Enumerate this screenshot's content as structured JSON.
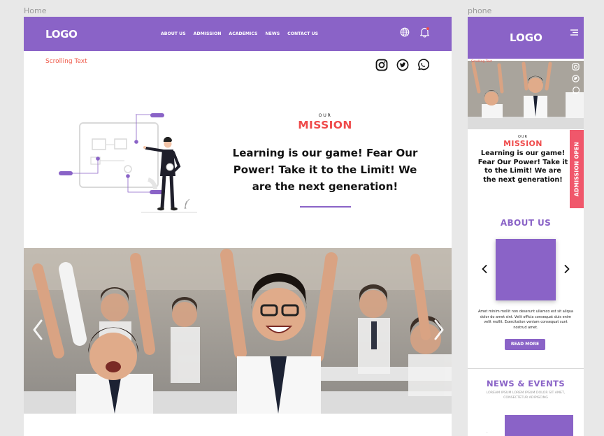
{
  "frames": {
    "home_label": "Home",
    "phone_label": "phone"
  },
  "header": {
    "logo": "LOGO",
    "nav": [
      "ABOUT US",
      "ADMISSION",
      "ACADEMICS",
      "NEWS",
      "CONTACT US"
    ],
    "icons": [
      "globe-icon",
      "bell-icon"
    ],
    "notification_dot_color": "#ef4b4b"
  },
  "scrolling_text": "Scrolling Text",
  "social_icons": [
    "instagram-icon",
    "twitter-icon",
    "whatsapp-icon"
  ],
  "mission": {
    "eyebrow": "OUR",
    "title": "MISSION",
    "text": "Learning is our game! Fear Our Power! Take it to the Limit! We are the next generation!"
  },
  "hero": {
    "image": "students-cheering-photo",
    "prev_icon": "chevron-left-icon",
    "next_icon": "chevron-right-icon"
  },
  "phone": {
    "logo": "LOGO",
    "menu_icon": "hamburger-icon",
    "scrolling_text": "Scrolling Text",
    "mission_eyebrow": "OUR",
    "mission_title": "MISSION",
    "mission_text": "Learning is our game! Fear Our Power! Take it to the Limit! We are the next generation!",
    "admission_tab": "ADMISSION OPEN",
    "about_title": "ABOUT US",
    "about_text": "Amet minim mollit non deserunt ullamco est sit aliqua dolor do amet sint. Velit officia consequat duis enim velit mollit. Exercitation veniam consequat sunt nostrud amet.",
    "read_more": "READ MORE",
    "news_title": "NEWS & EVENTS",
    "news_sub": "LOREAM IPSUM LOREM IPSUM DOLOR SIT AMET, CONSECTETUR ADIPISCING"
  },
  "colors": {
    "brand": "#8a63c7",
    "accent": "#ef4b4b",
    "admission": "#f0576b"
  }
}
